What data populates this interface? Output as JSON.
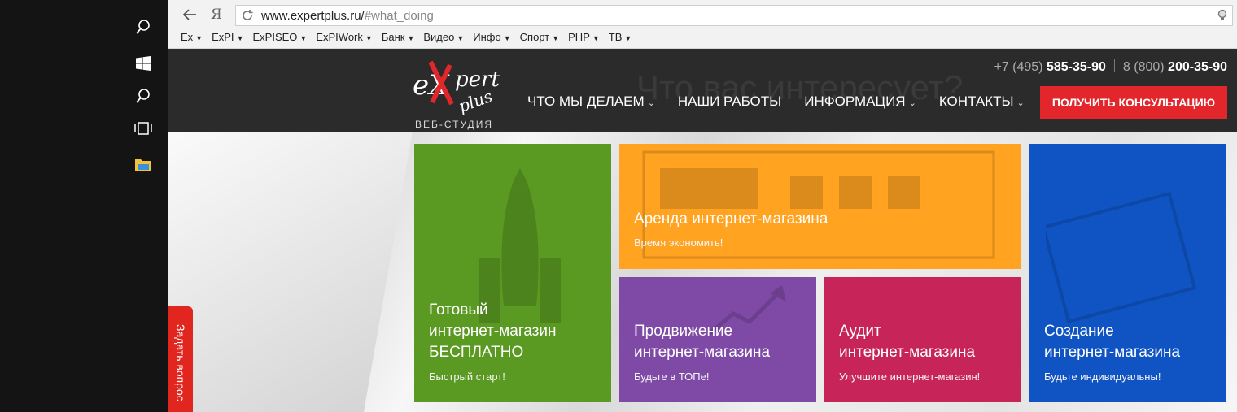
{
  "browser": {
    "yandex_label": "Я",
    "url_host": "www.expertplus.ru/",
    "url_fragment": "#what_doing",
    "bookmarks": [
      {
        "label": "Ex"
      },
      {
        "label": "ExPI"
      },
      {
        "label": "ExPISEO"
      },
      {
        "label": "ExPIWork"
      },
      {
        "label": "Банк"
      },
      {
        "label": "Видео"
      },
      {
        "label": "Инфо"
      },
      {
        "label": "Спорт"
      },
      {
        "label": "PHP"
      },
      {
        "label": "ТВ"
      }
    ],
    "caret": "▼"
  },
  "header": {
    "logo_text_1": "eX",
    "logo_text_2": "pert",
    "logo_text_3": "plus",
    "logo_subtitle": "ВЕБ-СТУДИЯ",
    "ghost_heading": "Что вас интересует?",
    "phone1_prefix": "+7 (495) ",
    "phone1_main": "585-35-90",
    "phone2_prefix": "8 (800) ",
    "phone2_main": "200-35-90",
    "menu": [
      {
        "label": "ЧТО МЫ ДЕЛАЕМ",
        "has_dropdown": true,
        "chevron": "⌄"
      },
      {
        "label": "НАШИ РАБОТЫ",
        "has_dropdown": false,
        "chevron": ""
      },
      {
        "label": "ИНФОРМАЦИЯ",
        "has_dropdown": true,
        "chevron": "⌄"
      },
      {
        "label": "КОНТАКТЫ",
        "has_dropdown": true,
        "chevron": "⌄"
      }
    ],
    "cta_label": "ПОЛУЧИТЬ КОНСУЛЬТАЦИЮ"
  },
  "tiles": {
    "green": {
      "title_1": "Готовый",
      "title_2": "интернет-магазин",
      "title_3": "БЕСПЛАТНО",
      "subtitle": "Быстрый старт!",
      "color": "#5a9a22"
    },
    "orange": {
      "title_1": "Аренда интернет-магазина",
      "subtitle": "Время экономить!",
      "color": "#ffa320"
    },
    "purple": {
      "title_1": "Продвижение",
      "title_2": "интернет-магазина",
      "subtitle": "Будьте в ТОПе!",
      "color": "#7e4aa6"
    },
    "red": {
      "title_1": "Аудит",
      "title_2": "интернет-магазина",
      "subtitle": "Улучшите интернет-магазин!",
      "color": "#c7245a"
    },
    "blue": {
      "title_1": "Создание",
      "title_2": "интернет-магазина",
      "subtitle": "Будьте индивидуальны!",
      "color": "#1054c4"
    }
  },
  "side_tab_label": "Задать вопрос",
  "colors": {
    "header_bg": "#2b2b2b",
    "cta_bg": "#e3262c",
    "taskbar_bg": "#141414"
  },
  "icons": [
    "search-icon",
    "windows-start-icon",
    "cortana-search-icon",
    "task-view-icon",
    "file-explorer-icon",
    "back-arrow-icon",
    "reload-icon",
    "lightbulb-icon"
  ]
}
